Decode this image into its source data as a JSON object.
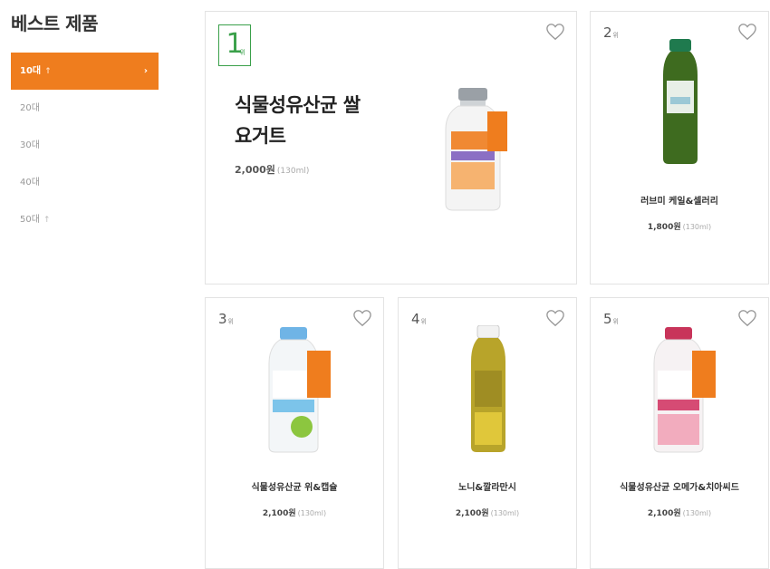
{
  "sidebar": {
    "title": "베스트 제품",
    "items": [
      {
        "label": "10대",
        "tag": "↑",
        "active": true,
        "arrow": "›"
      },
      {
        "label": "20대",
        "tag": ""
      },
      {
        "label": "30대",
        "tag": ""
      },
      {
        "label": "40대",
        "tag": ""
      },
      {
        "label": "50대",
        "tag": "↑"
      }
    ]
  },
  "featured": {
    "rank_num": "1",
    "rank_unit": "위",
    "name_line1": "식물성유산균 쌀",
    "name_line2": "요거트",
    "price": "2,000원",
    "volume": "(130ml)"
  },
  "products": [
    {
      "rank": "2",
      "rank_unit": "위",
      "name": "러브미 케일&셀러리",
      "price": "1,800원",
      "volume": "(130ml)"
    },
    {
      "rank": "3",
      "rank_unit": "위",
      "name": "식물성유산균 위&캡슐",
      "price": "2,100원",
      "volume": "(130ml)"
    },
    {
      "rank": "4",
      "rank_unit": "위",
      "name": "노니&깔라만시",
      "price": "2,100원",
      "volume": "(130ml)"
    },
    {
      "rank": "5",
      "rank_unit": "위",
      "name": "식물성유산균 오메가&치아씨드",
      "price": "2,100원",
      "volume": "(130ml)"
    }
  ],
  "icons": {
    "favorite": "heart-outline-icon"
  },
  "colors": {
    "accent": "#ef7d1e",
    "rank_green": "#3aa04a"
  }
}
